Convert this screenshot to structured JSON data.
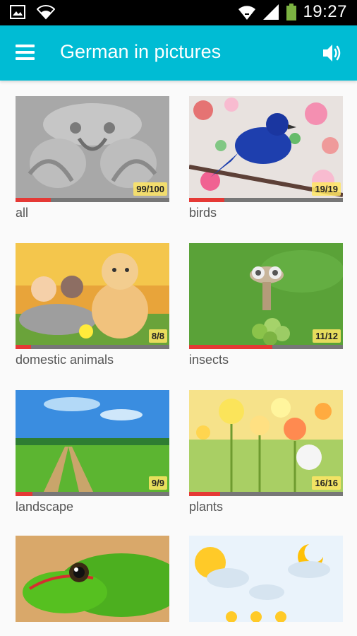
{
  "status_bar": {
    "time": "19:27",
    "icons": [
      "image-icon",
      "wifi-icon",
      "wifi-signal-icon",
      "cell-signal-icon",
      "battery-icon"
    ],
    "battery_color": "#7cb342"
  },
  "app_bar": {
    "title": "German in pictures",
    "bg_color": "#00bcd4",
    "menu_icon": "hamburger-menu-icon",
    "sound_icon": "speaker-icon"
  },
  "categories": [
    {
      "label": "all",
      "count": "99/100",
      "progress": 0.23
    },
    {
      "label": "birds",
      "count": "19/19",
      "progress": 0.23
    },
    {
      "label": "domestic animals",
      "count": "8/8",
      "progress": 0.1
    },
    {
      "label": "insects",
      "count": "11/12",
      "progress": 0.54
    },
    {
      "label": "landscape",
      "count": "9/9",
      "progress": 0.11
    },
    {
      "label": "plants",
      "count": "16/16",
      "progress": 0.2
    },
    {
      "label": "",
      "count": "",
      "progress": null
    },
    {
      "label": "",
      "count": "",
      "progress": null
    }
  ],
  "colors": {
    "progress_fill": "#e53935",
    "progress_track": "#777777",
    "badge_bg": "#ffe664"
  }
}
